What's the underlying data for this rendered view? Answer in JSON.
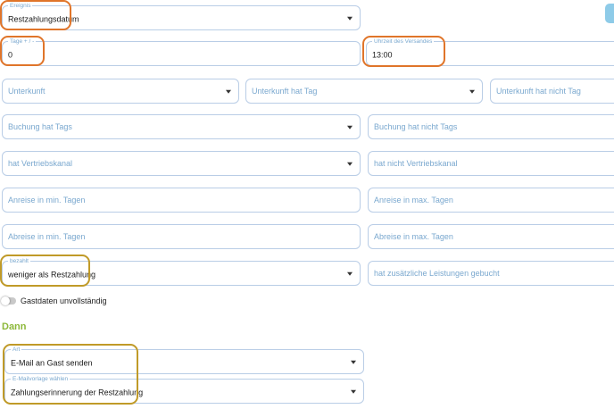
{
  "fields": {
    "ereignis": {
      "label": "Ereignis",
      "value": "Restzahlungsdatum"
    },
    "tage": {
      "label": "Tage + / -",
      "value": "0"
    },
    "uhrzeit": {
      "label": "Uhrzeit des Versandes",
      "value": "13:00"
    },
    "unterkunft": {
      "placeholder": "Unterkunft"
    },
    "unterkunft_hat_tag": {
      "placeholder": "Unterkunft hat Tag"
    },
    "unterkunft_hat_nicht_tag": {
      "placeholder": "Unterkunft hat nicht Tag"
    },
    "buchung_hat_tags": {
      "placeholder": "Buchung hat Tags"
    },
    "buchung_hat_nicht_tags": {
      "placeholder": "Buchung hat nicht Tags"
    },
    "hat_vertriebskanal": {
      "placeholder": "hat Vertriebskanal"
    },
    "hat_nicht_vertriebskanal": {
      "placeholder": "hat nicht Vertriebskanal"
    },
    "anreise_min": {
      "placeholder": "Anreise in min. Tagen"
    },
    "anreise_max": {
      "placeholder": "Anreise in max. Tagen"
    },
    "abreise_min": {
      "placeholder": "Abreise in min. Tagen"
    },
    "abreise_max": {
      "placeholder": "Abreise in max. Tagen"
    },
    "bezahlt": {
      "label": "bezahlt",
      "value": "weniger als Restzahlung"
    },
    "zusaetzliche_leistungen": {
      "placeholder": "hat zusätzliche Leistungen gebucht"
    },
    "art": {
      "label": "Art",
      "value": "E-Mail an Gast senden"
    },
    "vorlage": {
      "label": "E-Mailvorlage wählen",
      "value": "Zahlungserinnerung der Restzahlung"
    }
  },
  "toggle": {
    "label": "Gastdaten unvollständig",
    "checked": false
  },
  "section": {
    "title": "Dann"
  },
  "colors": {
    "accent": "#8db83a",
    "border": "#b9cde6",
    "placeholder": "#7aa8cf",
    "highlight_orange": "#e0752a",
    "highlight_gold": "#c09a28"
  }
}
